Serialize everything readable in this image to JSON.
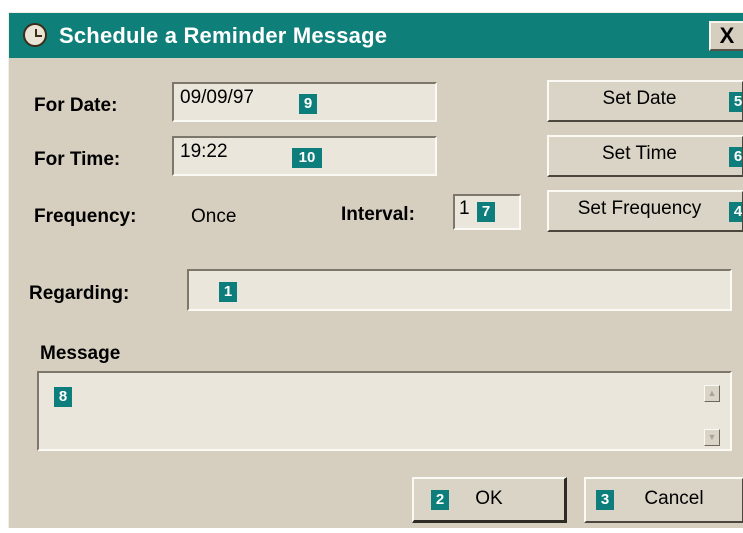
{
  "window": {
    "title": "Schedule a Reminder Message",
    "close": "X"
  },
  "date": {
    "label": "For Date:",
    "value": "09/09/97",
    "tag": "9"
  },
  "time": {
    "label": "For Time:",
    "value": "19:22",
    "tag": "10"
  },
  "frequency": {
    "label": "Frequency:",
    "value": "Once"
  },
  "interval": {
    "label": "Interval:",
    "value": "1",
    "tag": "7"
  },
  "buttons": {
    "set_date": {
      "label": "Set Date",
      "tag": "5"
    },
    "set_time": {
      "label": "Set Time",
      "tag": "6"
    },
    "set_frequency": {
      "label": "Set Frequency",
      "tag": "4"
    },
    "ok": {
      "label": "OK",
      "tag": "2"
    },
    "cancel": {
      "label": "Cancel",
      "tag": "3"
    }
  },
  "regarding": {
    "label": "Regarding:",
    "value": "",
    "tag": "1"
  },
  "message": {
    "label": "Message",
    "value": "",
    "tag": "8"
  },
  "icons": [
    "alarm-clock-icon",
    "close-icon",
    "scroll-up-icon",
    "scroll-down-icon"
  ],
  "colors": {
    "titlebar": "#0f7f7a",
    "tag": "#0d7e7b",
    "dialog_bg": "#d6cfbf"
  }
}
